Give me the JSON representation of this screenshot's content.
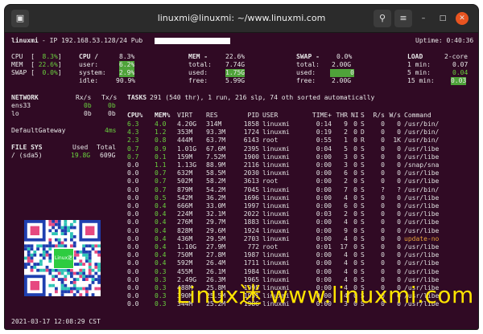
{
  "window": {
    "title": "linuxmi@linuxmi: ~/www.linuxmi.com",
    "new_tab_icon": "terminal-tab-icon",
    "search_icon": "search-icon",
    "menu_icon": "hamburger-menu-icon",
    "minimize": "–",
    "maximize": "□",
    "close": "✕"
  },
  "top": {
    "host": "linuxmi",
    "ip_text": "- IP 192.168.53.128/24 Pub",
    "uptime": "Uptime: 0:40:36"
  },
  "cpu_bars": {
    "cpu": "CPU  [  8.3%]",
    "mem": "MEM  [ 22.6%]",
    "swap": "SWAP [  0.0%]"
  },
  "cpu": {
    "title": "CPU /",
    "pct": "8.3%",
    "user_l": "user:",
    "user": "6.2%",
    "system_l": "system:",
    "system": "2.9%",
    "idle_l": "idle:",
    "idle": "90.9%"
  },
  "mem": {
    "title": "MEM -",
    "pct": "22.6%",
    "total_l": "total:",
    "total": "7.74G",
    "used_l": "used:",
    "used": "1.75G",
    "free_l": "free:",
    "free": "5.99G"
  },
  "swap": {
    "title": "SWAP -",
    "pct": "0.0%",
    "total_l": "total:",
    "total": "2.00G",
    "used_l": "used:",
    "used": "0",
    "free_l": "free:",
    "free": "2.00G"
  },
  "load": {
    "title": "LOAD",
    "cores": "2-core",
    "m1_l": "1 min:",
    "m1": "0.07",
    "m5_l": "5 min:",
    "m5": "0.04",
    "m15_l": "15 min:",
    "m15": "0.03"
  },
  "network": {
    "title": "NETWORK",
    "rx": "Rx/s",
    "tx": "Tx/s",
    "ifaces": [
      {
        "name": "ens33",
        "rx": "0b",
        "tx": "0b"
      },
      {
        "name": "lo",
        "rx": "0b",
        "tx": "0b"
      }
    ],
    "gw_label": "DefaultGateway",
    "gw_val": "4ms"
  },
  "fs": {
    "title": "FILE SYS",
    "used_h": "Used",
    "total_h": "Total",
    "mount": "/ (sda5)",
    "used": "19.8G",
    "total": "609G"
  },
  "tasks": {
    "label": "TASKS",
    "summary": "291 (540 thr), 1 run, 216 slp, 74 oth sorted automatically"
  },
  "proc_header": [
    "CPU%",
    "MEM%",
    "VIRT",
    "RES",
    "PID",
    "USER",
    "TIME+",
    "THR",
    "NI",
    "S",
    "R/s",
    "W/s",
    "Command"
  ],
  "processes": [
    [
      "6.3",
      "4.0",
      "4.20G",
      "314M",
      "1858",
      "linuxmi",
      "0:14",
      "9",
      "0",
      "S",
      "0",
      "0",
      "/usr/bin/"
    ],
    [
      "4.3",
      "1.2",
      "353M",
      "93.3M",
      "1724",
      "linuxmi",
      "0:19",
      "2",
      "0",
      "D",
      "0",
      "0",
      "/usr/bin/"
    ],
    [
      "2.3",
      "0.8",
      "444M",
      "63.7M",
      "6143",
      "root",
      "0:55",
      "1",
      "0",
      "R",
      "0",
      "1K",
      "/usr/bin/"
    ],
    [
      "0.7",
      "0.9",
      "1.01G",
      "67.6M",
      "2395",
      "linuxmi",
      "0:04",
      "5",
      "0",
      "S",
      "0",
      "0",
      "/usr/libe"
    ],
    [
      "0.7",
      "0.1",
      "159M",
      "7.52M",
      "1900",
      "linuxmi",
      "0:00",
      "3",
      "0",
      "S",
      "0",
      "0",
      "/usr/libe"
    ],
    [
      "0.0",
      "1.1",
      "1.13G",
      "88.9M",
      "2116",
      "linuxmi",
      "0:00",
      "3",
      "0",
      "S",
      "0",
      "0",
      "/snap/sna"
    ],
    [
      "0.0",
      "0.7",
      "632M",
      "58.5M",
      "2030",
      "linuxmi",
      "0:00",
      "6",
      "0",
      "S",
      "0",
      "0",
      "/usr/libe"
    ],
    [
      "0.0",
      "0.7",
      "502M",
      "58.2M",
      "3613",
      "root",
      "0:00",
      "2",
      "0",
      "S",
      "0",
      "0",
      "/usr/libe"
    ],
    [
      "0.0",
      "0.7",
      "879M",
      "54.2M",
      "7045",
      "linuxmi",
      "0:00",
      "7",
      "0",
      "S",
      "?",
      "?",
      "/usr/bin/"
    ],
    [
      "0.0",
      "0.5",
      "542M",
      "36.2M",
      "1696",
      "linuxmi",
      "0:00",
      "4",
      "0",
      "S",
      "0",
      "0",
      "/usr/libe"
    ],
    [
      "0.0",
      "0.4",
      "666M",
      "33.0M",
      "1997",
      "linuxmi",
      "0:00",
      "6",
      "0",
      "S",
      "0",
      "0",
      "/usr/libe"
    ],
    [
      "0.0",
      "0.4",
      "224M",
      "32.1M",
      "2022",
      "linuxmi",
      "0:03",
      "2",
      "0",
      "S",
      "0",
      "0",
      "/usr/libe"
    ],
    [
      "0.0",
      "0.4",
      "276M",
      "29.7M",
      "1883",
      "linuxmi",
      "0:00",
      "4",
      "0",
      "S",
      "0",
      "0",
      "/usr/libe"
    ],
    [
      "0.0",
      "0.4",
      "828M",
      "29.6M",
      "1924",
      "linuxmi",
      "0:00",
      "9",
      "0",
      "S",
      "0",
      "0",
      "/usr/libe"
    ],
    [
      "0.0",
      "0.4",
      "436M",
      "29.5M",
      "2703",
      "linuxmi",
      "0:00",
      "4",
      "0",
      "S",
      "0",
      "0",
      "update-no"
    ],
    [
      "0.0",
      "0.4",
      "1.10G",
      "27.9M",
      "772",
      "root",
      "0:01",
      "17",
      "0",
      "S",
      "0",
      "0",
      "/usr/libe"
    ],
    [
      "0.0",
      "0.4",
      "750M",
      "27.8M",
      "1987",
      "linuxmi",
      "0:00",
      "4",
      "0",
      "S",
      "0",
      "0",
      "/usr/libe"
    ],
    [
      "0.0",
      "0.4",
      "592M",
      "26.4M",
      "1711",
      "linuxmi",
      "0:00",
      "4",
      "0",
      "S",
      "0",
      "0",
      "/usr/libe"
    ],
    [
      "0.0",
      "0.3",
      "455M",
      "26.1M",
      "1984",
      "linuxmi",
      "0:00",
      "4",
      "0",
      "S",
      "0",
      "0",
      "/usr/libe"
    ],
    [
      "0.0",
      "0.3",
      "2.49G",
      "26.3M",
      "1965",
      "linuxmi",
      "0:00",
      "4",
      "0",
      "S",
      "0",
      "0",
      "/usr/libe"
    ],
    [
      "0.0",
      "0.3",
      "488M",
      "25.8M",
      "1995",
      "linuxmi",
      "0:00",
      "4",
      "0",
      "S",
      "0",
      "0",
      "/usr/libe"
    ],
    [
      "0.0",
      "0.3",
      "390M",
      "25.5M",
      "1951",
      "linuxmi",
      "0:00",
      "4",
      "0",
      "S",
      "0",
      "0",
      "/usr/libe"
    ],
    [
      "0.0",
      "0.3",
      "344M",
      "25.2M",
      "1986",
      "linuxmi",
      "0:00",
      "3",
      "0",
      "S",
      "0",
      "0",
      "/usr/libe"
    ]
  ],
  "bottom": {
    "datetime": "2021-03-17 12:08:29 CST"
  },
  "watermark": {
    "text": "Linux迷 www.linuxmi.com",
    "qr_label": "Linux迷"
  },
  "colors": {
    "bg": "#300a24",
    "green": "#6ad23e",
    "highlight": "#4fa33a",
    "watermark": "#ffe400"
  }
}
